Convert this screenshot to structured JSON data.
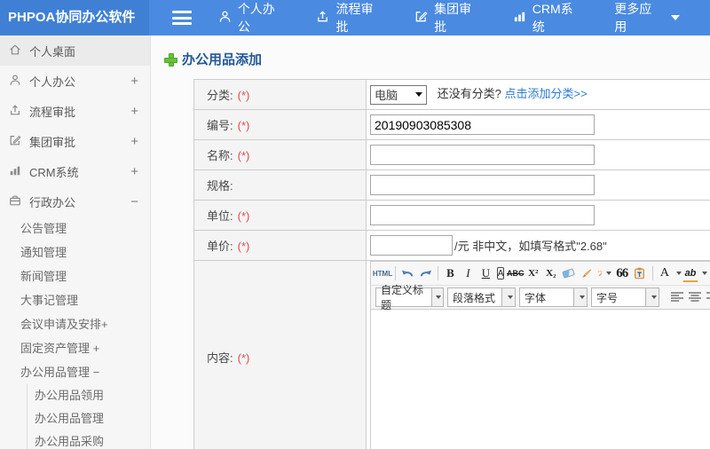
{
  "topbar": {
    "logo": "PHPOA协同办公软件",
    "nav": [
      {
        "label": "个人办公",
        "icon": "user-icon"
      },
      {
        "label": "流程审批",
        "icon": "flow-icon"
      },
      {
        "label": "集团审批",
        "icon": "edit-icon"
      },
      {
        "label": "CRM系统",
        "icon": "chart-icon"
      },
      {
        "label": "更多应用",
        "icon": "caret-down-icon"
      }
    ]
  },
  "sidebar": {
    "items": [
      {
        "label": "个人桌面",
        "icon": "home-icon",
        "expander": ""
      },
      {
        "label": "个人办公",
        "icon": "user-icon",
        "expander": "+"
      },
      {
        "label": "流程审批",
        "icon": "flow-icon",
        "expander": "+"
      },
      {
        "label": "集团审批",
        "icon": "edit-icon",
        "expander": "+"
      },
      {
        "label": "CRM系统",
        "icon": "chart-icon",
        "expander": "+"
      },
      {
        "label": "行政办公",
        "icon": "briefcase-icon",
        "expander": "−"
      }
    ],
    "admin_submenu": [
      {
        "label": "公告管理"
      },
      {
        "label": "通知管理"
      },
      {
        "label": "新闻管理"
      },
      {
        "label": "大事记管理"
      },
      {
        "label": "会议申请及安排+"
      },
      {
        "label": "固定资产管理 +"
      },
      {
        "label": "办公用品管理 −"
      }
    ],
    "supplies_submenu": [
      {
        "label": "办公用品领用"
      },
      {
        "label": "办公用品管理"
      },
      {
        "label": "办公用品采购"
      }
    ]
  },
  "page": {
    "title": "办公用品添加"
  },
  "form": {
    "required_mark": "(*)",
    "category": {
      "label": "分类:",
      "selected": "电脑",
      "hint": "还没有分类?",
      "add_link": "点击添加分类>>"
    },
    "code": {
      "label": "编号:",
      "value": "20190903085308"
    },
    "name": {
      "label": "名称:",
      "value": ""
    },
    "spec": {
      "label": "规格:",
      "value": ""
    },
    "unit": {
      "label": "单位:",
      "value": ""
    },
    "price": {
      "label": "单价:",
      "value": "",
      "suffix": "/元 非中文，如填写格式\"2.68\""
    },
    "content": {
      "label": "内容:"
    }
  },
  "editor": {
    "buttons": {
      "html": "HTML",
      "bold": "B",
      "italic": "I",
      "underline": "U",
      "border_a": "A",
      "strike": "ABC",
      "superscript": "X²",
      "subscript": "X₂",
      "quote": "66",
      "font_color": "A",
      "highlight": "ab"
    },
    "dropdowns": [
      {
        "label": "自定义标题"
      },
      {
        "label": "段落格式"
      },
      {
        "label": "字体"
      },
      {
        "label": "字号"
      }
    ],
    "icon_names": [
      "undo-icon",
      "redo-icon",
      "eraser-icon",
      "format-painter-icon",
      "auto-typeset-icon",
      "paste-text-icon",
      "align-left-icon",
      "align-center-icon",
      "align-right-icon",
      "align-justify-icon",
      "link-icon"
    ]
  },
  "colors": {
    "topbar": "#4a8ae0",
    "logo_bg": "#4080d4",
    "title": "#235a96",
    "link": "#2b7bd4",
    "required": "#e14c4c",
    "plus_green": "#67c23a"
  }
}
